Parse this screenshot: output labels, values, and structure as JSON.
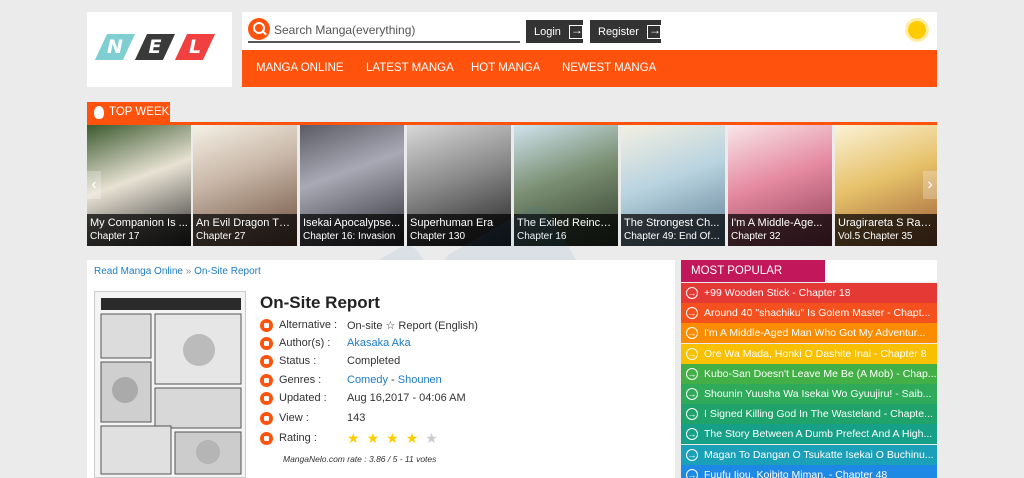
{
  "logo": {
    "letters": [
      "N",
      "E",
      "L"
    ]
  },
  "search": {
    "placeholder": "Search Manga(everything)"
  },
  "auth": {
    "login_label": "Login",
    "register_label": "Register"
  },
  "nav": {
    "items": [
      "MANGA ONLINE",
      "LATEST MANGA",
      "HOT MANGA",
      "NEWEST MANGA"
    ]
  },
  "top_week": {
    "label": "TOP WEEK",
    "slides": [
      {
        "title": "My Companion Is ...",
        "chapter": "Chapter 17"
      },
      {
        "title": "An Evil Dragon Th...",
        "chapter": "Chapter 27"
      },
      {
        "title": "Isekai Apocalypse...",
        "chapter": "Chapter 16: Invasion"
      },
      {
        "title": "Superhuman Era",
        "chapter": "Chapter 130"
      },
      {
        "title": "The Exiled Reinca...",
        "chapter": "Chapter 16"
      },
      {
        "title": "The Strongest Ch...",
        "chapter": "Chapter 49: End Of S..."
      },
      {
        "title": "I'm A Middle-Age...",
        "chapter": "Chapter 32"
      },
      {
        "title": "Uragirareta S Ran...",
        "chapter": "Vol.5 Chapter 35"
      }
    ]
  },
  "breadcrumb": {
    "home": "Read Manga Online",
    "separator": "»",
    "current": "On-Site Report"
  },
  "manga": {
    "title": "On-Site Report",
    "alternative_label": "Alternative :",
    "alternative_value": "On-site ☆ Report (English)",
    "authors_label": "Author(s) :",
    "authors_value": "Akasaka Aka",
    "status_label": "Status :",
    "status_value": "Completed",
    "genres_label": "Genres :",
    "genre_1": "Comedy",
    "genre_sep": " - ",
    "genre_2": "Shounen",
    "updated_label": "Updated :",
    "updated_value": "Aug 16,2017 - 04:06 AM",
    "view_label": "View :",
    "view_value": "143",
    "rating_label": "Rating :",
    "rating_stars": 4,
    "rating_max": 5,
    "rate_note": "MangaNelo.com rate : 3.86 / 5 - 11 votes"
  },
  "popular": {
    "label": "MOST POPULAR MANGA",
    "items": [
      {
        "text": "+99 Wooden Stick - Chapter 18",
        "color": "#e53935"
      },
      {
        "text": "Around 40 \"shachiku\" Is Golem Master - Chapt...",
        "color": "#f4511e"
      },
      {
        "text": "I'm A Middle-Aged Man Who Got My Adventur...",
        "color": "#fb8c00"
      },
      {
        "text": "Ore Wa Mada, Honki O Dashite Inai - Chapter 8",
        "color": "#f9c000"
      },
      {
        "text": "Kubo-San Doesn't Leave Me Be (A Mob) - Chap...",
        "color": "#43b047"
      },
      {
        "text": "Shounin Yuusha Wa Isekai Wo Gyuujiru! - Saib...",
        "color": "#2eaa5a"
      },
      {
        "text": "I Signed Killing God In The Wasteland - Chapte...",
        "color": "#1fa36b"
      },
      {
        "text": "The Story Between A Dumb Prefect And A High...",
        "color": "#17a088"
      },
      {
        "text": "Magan To Dangan O Tsukatte Isekai O Buchinu...",
        "color": "#1aa0b8"
      },
      {
        "text": "Fuufu Ijou, Koibito Miman. - Chapter 48",
        "color": "#1e88e5"
      }
    ]
  }
}
